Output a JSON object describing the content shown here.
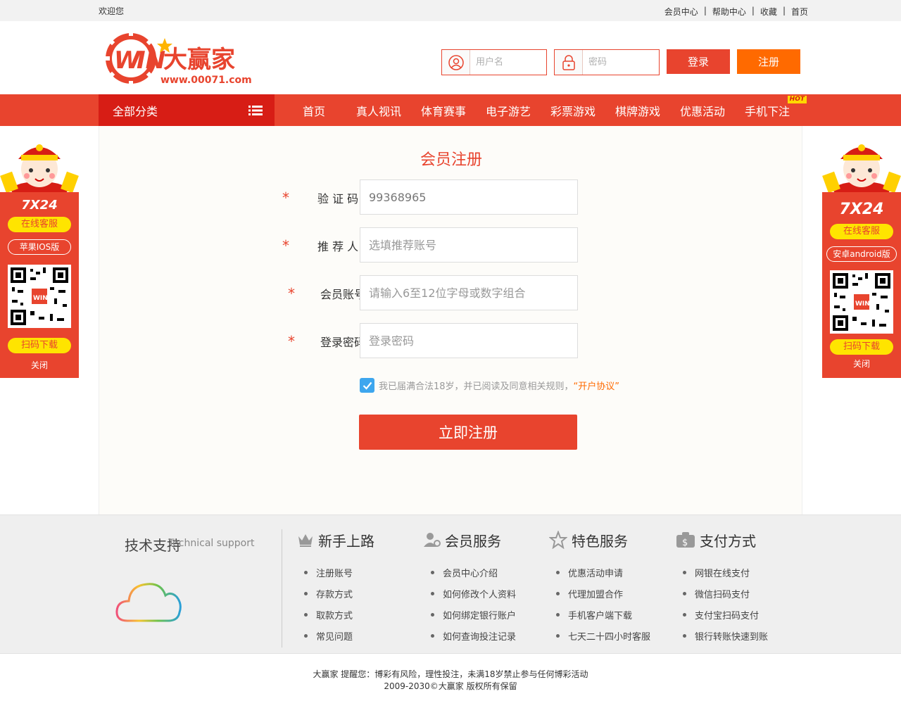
{
  "topbar": {
    "welcome": "欢迎您",
    "links": [
      "会员中心",
      "帮助中心",
      "收藏",
      "首页"
    ]
  },
  "brand": {
    "logo_text": "WIN大赢家",
    "logo_url_text": "www.00071.com"
  },
  "login": {
    "username_placeholder": "用户名",
    "password_placeholder": "密码",
    "login_label": "登录",
    "register_label": "注册"
  },
  "nav": {
    "category_label": "全部分类",
    "items": [
      "首页",
      "真人视讯",
      "体育赛事",
      "电子游艺",
      "彩票游戏",
      "棋牌游戏",
      "优惠活动",
      "手机下注"
    ],
    "hot_badge": "HOT"
  },
  "form": {
    "title": "会员注册",
    "fields": [
      {
        "label": "验 证 码",
        "value": "99368965",
        "placeholder": ""
      },
      {
        "label": "推 荐 人",
        "value": "",
        "placeholder": "选填推荐账号"
      },
      {
        "label": "会员账号",
        "value": "",
        "placeholder": "请输入6至12位字母或数字组合"
      },
      {
        "label": "登录密码",
        "value": "",
        "placeholder": "登录密码"
      }
    ],
    "agree_text": "我已届满合法18岁，并已阅读及同意相关规则，",
    "agree_link": "“开户协议”",
    "submit_label": "立即注册"
  },
  "float_left": {
    "badge": "7X24",
    "cta_top": "在线客服",
    "platform": "苹果IOS版",
    "cta_bottom": "扫码下载",
    "close": "关闭"
  },
  "float_right": {
    "badge": "7X24",
    "cta_top": "在线客服",
    "platform": "安卓android版",
    "cta_bottom": "扫码下载",
    "close": "关闭"
  },
  "footer": {
    "tech_title": "技术支持",
    "tech_sub": "Technical support",
    "columns": [
      {
        "icon": "crown-icon",
        "title": "新手上路",
        "items": [
          "注册账号",
          "存款方式",
          "取款方式",
          "常见问题"
        ]
      },
      {
        "icon": "user-gear-icon",
        "title": "会员服务",
        "items": [
          "会员中心介绍",
          "如何修改个人资料",
          "如何绑定银行账户",
          "如何查询投注记录"
        ]
      },
      {
        "icon": "star-icon",
        "title": "特色服务",
        "items": [
          "优惠活动申请",
          "代理加盟合作",
          "手机客户端下载",
          "七天二十四小时客服"
        ]
      },
      {
        "icon": "money-bag-icon",
        "title": "支付方式",
        "items": [
          "网银在线支付",
          "微信扫码支付",
          "支付宝扫码支付",
          "银行转账快速到账"
        ]
      }
    ],
    "copyright_line1": "大赢家 提醒您：博彩有风险，理性投注，未满18岁禁止参与任何博彩活动",
    "copyright_line2": "2009-2030©大赢家 版权所有保留"
  },
  "colors": {
    "primary_red": "#e8442e",
    "dark_red": "#d71d15",
    "orange": "#ff6a00",
    "check_blue": "#3da6ee",
    "yellow": "#ffe400"
  }
}
